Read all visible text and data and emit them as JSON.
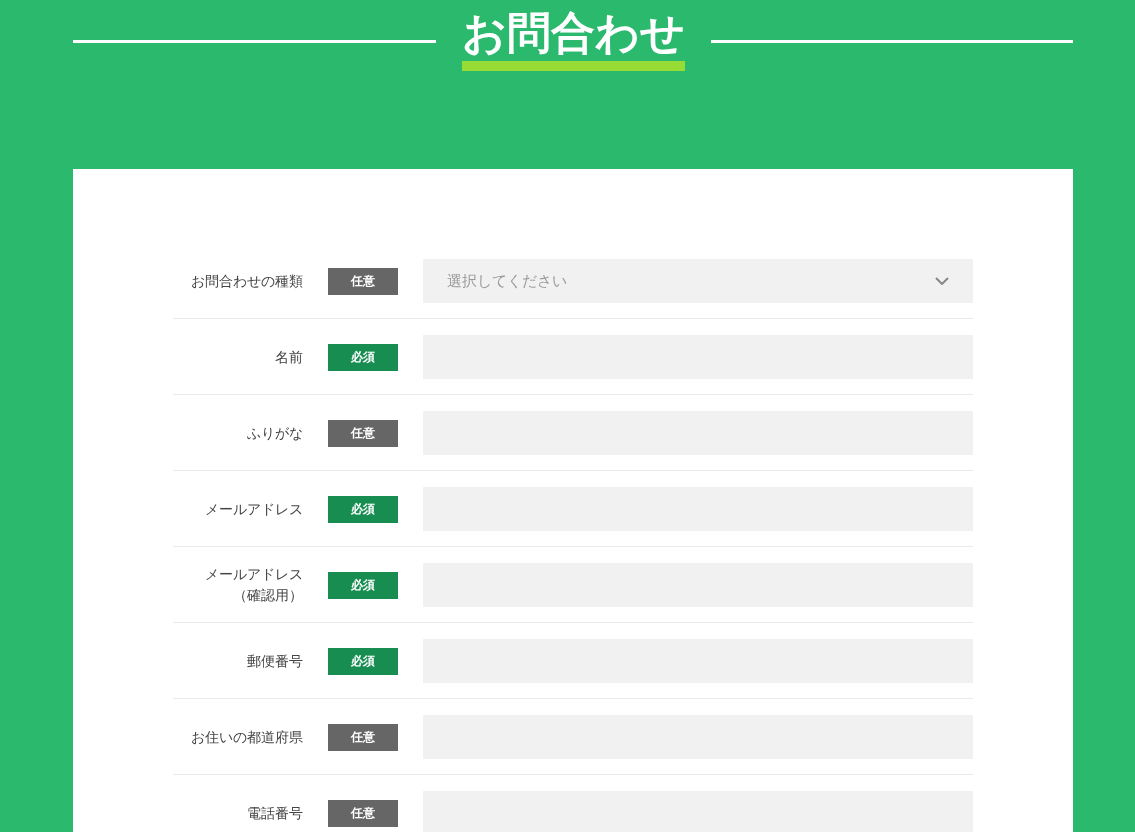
{
  "title": "お問合わせ",
  "fields": [
    {
      "label": "お問合わせの種類",
      "badge": "任意",
      "required": false,
      "kind": "select",
      "placeholder": "選択してください"
    },
    {
      "label": "名前",
      "badge": "必須",
      "required": true,
      "kind": "text"
    },
    {
      "label": "ふりがな",
      "badge": "任意",
      "required": false,
      "kind": "text"
    },
    {
      "label": "メールアドレス",
      "badge": "必須",
      "required": true,
      "kind": "text"
    },
    {
      "label": "メールアドレス",
      "note": "（確認用）",
      "badge": "必須",
      "required": true,
      "kind": "text"
    },
    {
      "label": "郵便番号",
      "badge": "必須",
      "required": true,
      "kind": "text"
    },
    {
      "label": "お住いの都道府県",
      "badge": "任意",
      "required": false,
      "kind": "text"
    },
    {
      "label": "電話番号",
      "badge": "任意",
      "required": false,
      "kind": "text"
    }
  ]
}
